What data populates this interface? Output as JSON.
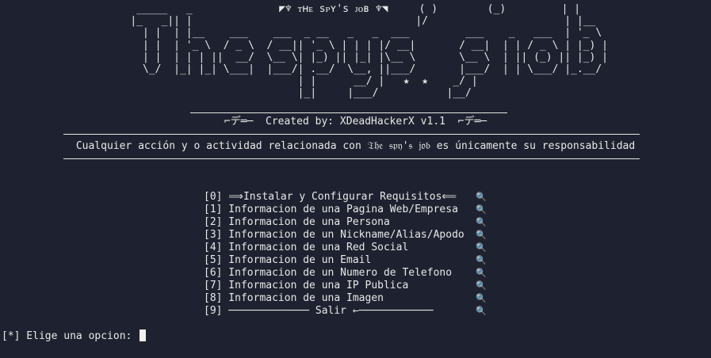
{
  "banner": {
    "ascii_art": "                      _____   _              ◤♆ ᴛʜᴇ sᴘʏ's ᴊᴏʙ ♆◥     ( )        (_)         | |\n                     |_   _|| |                                    |/                      | |__\n                       | |  | |__    ___    ___  _ __   _   _  ___         ___    _   ___  | '_ \\\n                       | |  | '_ \\  / _ \\  / __|| '_ \\ | | | |/ __|       / __|  | | / _ \\ | |_) |\n                       | |  | | | ||  __/  \\__ \\| |_) || |_| |\\__ \\       \\__ \\  | || (_) || |_) |\n                       \\_/  |_| |_| \\___|  |___/| .__/  \\__, ||___/       |___/  | | \\___/ |_.__/\n                                                | |      __/ |   ★  ★    _/ |\n                                                |_|     |___/           |__/"
  },
  "credits": {
    "left_glyph": "⌐デ═─",
    "text": "Created by: XDeadHackerX v1.1",
    "right_glyph": "⌐デ═─"
  },
  "disclaimer": {
    "prefix": "Cualquier acción y o actividad relacionada con ",
    "brand": "𝔗𝔥𝔢 𝔰𝔭𝔶'𝔰 𝔧𝔬𝔟",
    "suffix": " es únicamente su responsabilidad"
  },
  "menu": {
    "items": [
      {
        "label": "[0] ⟹Instalar y Configurar Requisitos⟸"
      },
      {
        "label": "[1] Informacion de una Pagina Web/Empresa"
      },
      {
        "label": "[2] Informacion de una Persona"
      },
      {
        "label": "[3] Informacion de un Nickname/Alias/Apodo"
      },
      {
        "label": "[4] Informacion de una Red Social"
      },
      {
        "label": "[5] Informacion de un Email"
      },
      {
        "label": "[6] Informacion de un Numero de Telefono"
      },
      {
        "label": "[7] Informacion de una IP Publica"
      },
      {
        "label": "[8] Informacion de una Imagen"
      },
      {
        "label": "[9] ───────────── Salir ←────────────"
      }
    ],
    "icon_glyph": "🔍",
    "icon": "magnifier-icon"
  },
  "prompt": {
    "text": "[*] Elige una opcion: "
  },
  "colors": {
    "background": "#1e2230",
    "foreground": "#e8e8e8",
    "icon": "#7fb8e8"
  }
}
